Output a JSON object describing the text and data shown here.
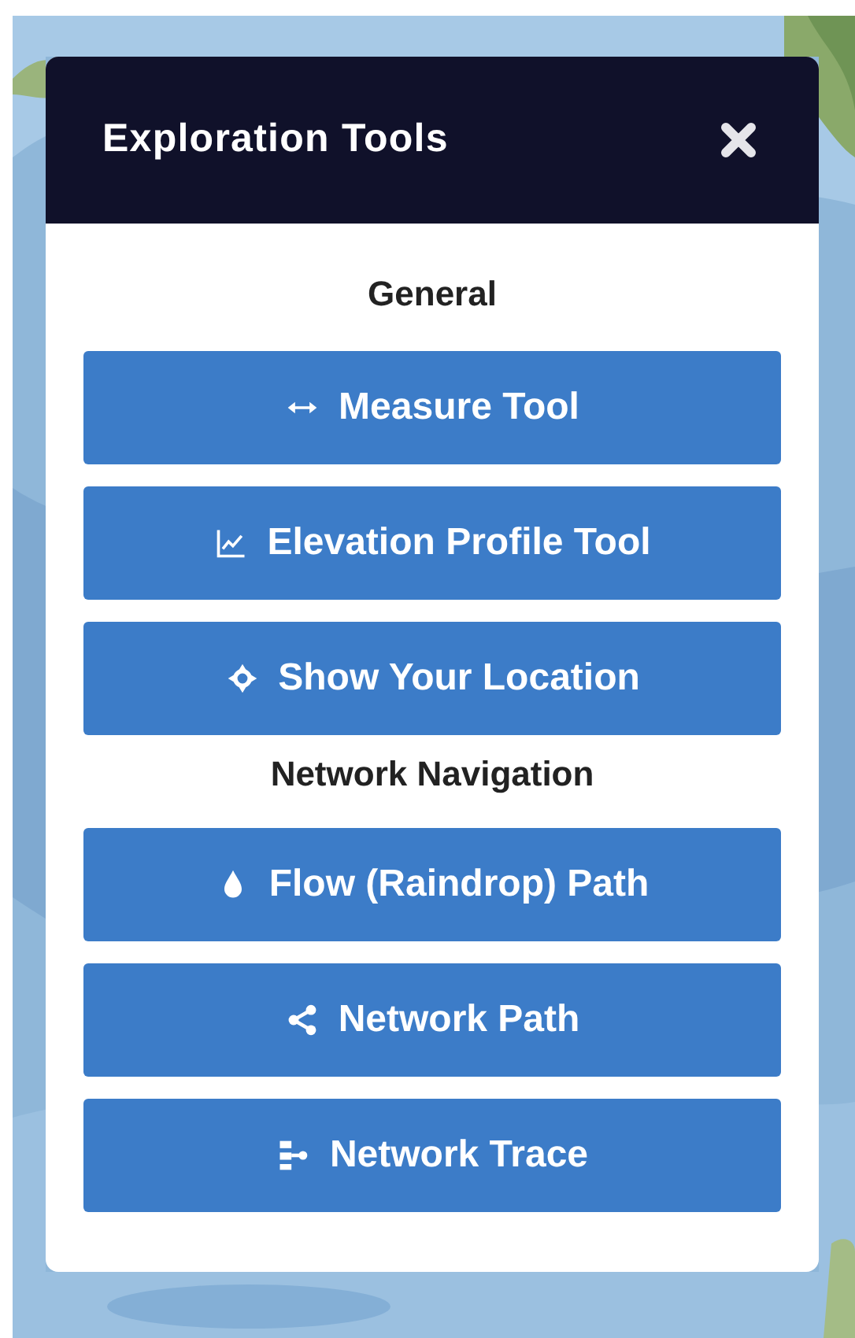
{
  "panel": {
    "title": "Exploration Tools"
  },
  "sections": [
    {
      "heading": "General",
      "tools": [
        "Measure Tool",
        "Elevation Profile Tool",
        "Show Your Location"
      ]
    },
    {
      "heading": "Network Navigation",
      "tools": [
        "Flow (Raindrop) Path",
        "Network Path",
        "Network Trace"
      ]
    }
  ]
}
